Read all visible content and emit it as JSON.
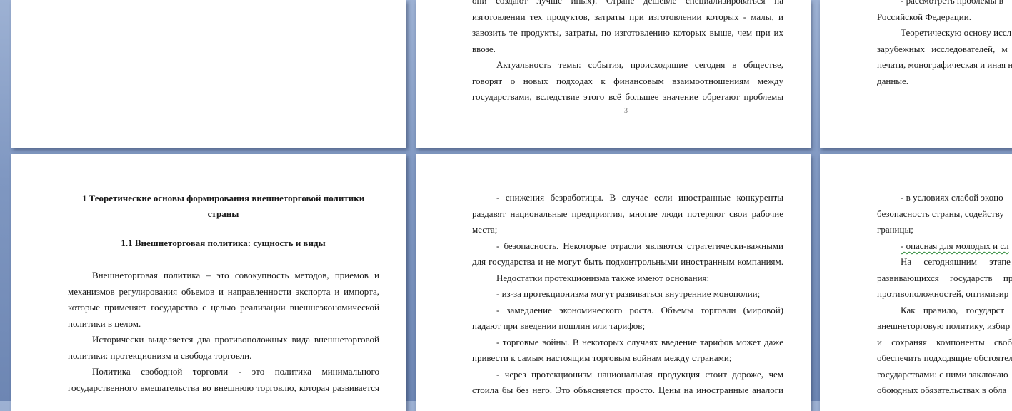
{
  "page2_top": {
    "lines": [
      "они создают лучше иных). Стране дешевле специализироваться на",
      "изготовлении тех продуктов, затраты при изготовлении которых - малы, и",
      "завозить те продукты, затраты, по изготовлению которых выше, чем при их",
      "ввозе.",
      "Актуальность темы: события, происходящие сегодня в обществе,",
      "говорят о новых подходах к финансовым взаимоотношениям между",
      "государствами, вследствие этого всё большее значение обретают проблемы"
    ],
    "page_number": "3"
  },
  "page3_top": {
    "lines": [
      "- рассмотреть проблемы в",
      "Российской Федерации.",
      "Теоретическую основу иссл",
      "зарубежных исследователей, м",
      "печати, монографическая и иная н",
      "данные."
    ]
  },
  "page4": {
    "heading_line1": "1 Теоретические основы формирования внешнеторговой политики",
    "heading_line2": "страны",
    "subheading": "1.1 Внешнеторговая политика: сущность и виды",
    "lines": [
      "Внешнеторговая политика – это совокупность методов, приемов и",
      "механизмов регулирования объемов и направленности экспорта и импорта,",
      "которые применяет государство с целью реализации внешнеэкономической",
      "политики в целом.",
      "Исторически выделяется два противоположных вида внешнеторговой",
      "политики: протекционизм и свобода торговли.",
      "Политика свободной торговли - это политика минимального",
      "государственного вмешательства во внешнюю торговлю, которая развивается"
    ]
  },
  "page5": {
    "lines": [
      "- снижения безработицы. В случае если иностранные конкуренты",
      "раздавят национальные предприятия, многие люди потеряют свои рабочие",
      "места;",
      "- безопасность. Некоторые отрасли являются стратегически-важными",
      "для государства и не могут быть подконтрольными иностранным компаниям.",
      "Недостатки протекционизма также имеют основания:",
      "- из-за протекционизма могут развиваться внутренние монополии;",
      "- замедление экономического роста. Объемы торговли (мировой)",
      "падают при введении пошлин или тарифов;",
      "- торговые войны. В некоторых случаях введение тарифов может даже",
      "привести к самым настоящим торговым войнам между странами;",
      "- через протекционизм национальная продукция стоит дороже, чем",
      "стоила бы без него. Это объясняется просто. Цены на иностранные аналоги"
    ]
  },
  "page6": {
    "lines": [
      "- в условиях слабой эконо",
      "безопасность страны, содейству",
      "границы;",
      "- опасная для молодых и сл",
      "На сегодняшним этапе",
      "развивающихся государств пре",
      "противоположностей, оптимизир",
      "Как правило, государст",
      "внешнеторговую политику, избир",
      "и сохраняя компоненты свобо",
      "обеспечить подходящие обстоятел",
      "государствами: с ними заключаю",
      "обоюдных обязательствах в обла"
    ]
  }
}
